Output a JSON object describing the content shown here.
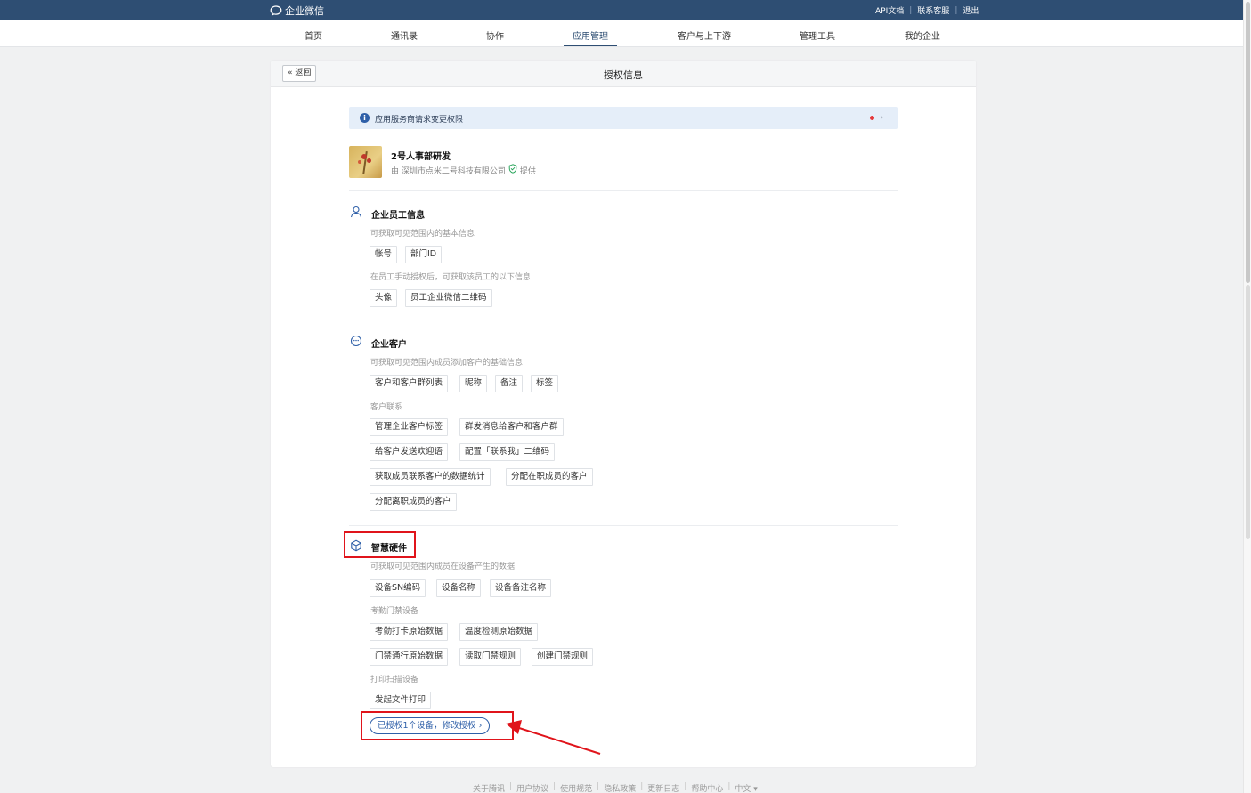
{
  "topbar": {
    "logo": "企业微信",
    "links": [
      "API文档",
      "联系客服",
      "退出"
    ]
  },
  "nav": {
    "items": [
      "首页",
      "通讯录",
      "协作",
      "应用管理",
      "客户与上下游",
      "管理工具",
      "我的企业"
    ],
    "active": "应用管理"
  },
  "header": {
    "back": "« 返回",
    "title": "授权信息"
  },
  "banner": {
    "text": "应用服务商请求变更权限"
  },
  "app": {
    "name": "2号人事部研发",
    "provider": "由 深圳市点米二号科技有限公司",
    "provider_suffix": "提供"
  },
  "sections": {
    "employee": {
      "title": "企业员工信息",
      "sub1": "可获取可见范围内的基本信息",
      "tags1": [
        "帐号",
        "部门ID"
      ],
      "sub2": "在员工手动授权后，可获取该员工的以下信息",
      "tags2": [
        "头像",
        "员工企业微信二维码"
      ]
    },
    "customer": {
      "title": "企业客户",
      "sub1": "可获取可见范围内成员添加客户的基础信息",
      "tags1": [
        "客户和客户群列表",
        "昵称",
        "备注",
        "标签"
      ],
      "sub2": "客户联系",
      "tags2": [
        "管理企业客户标签",
        "群发消息给客户和客户群",
        "给客户发送欢迎语",
        "配置「联系我」二维码",
        "获取成员联系客户的数据统计",
        "分配在职成员的客户",
        "分配离职成员的客户"
      ]
    },
    "hardware": {
      "title": "智慧硬件",
      "sub1": "可获取可见范围内成员在设备产生的数据",
      "tags1": [
        "设备SN编码",
        "设备名称",
        "设备备注名称"
      ],
      "sub2": "考勤门禁设备",
      "tags2": [
        "考勤打卡原始数据",
        "温度检测原始数据",
        "门禁通行原始数据",
        "读取门禁规则",
        "创建门禁规则"
      ],
      "sub3": "打印扫描设备",
      "tags3": [
        "发起文件打印"
      ],
      "auth_link": "已授权1个设备，修改授权 ›"
    }
  },
  "footer": {
    "links": [
      "关于腾讯",
      "用户协议",
      "使用规范",
      "隐私政策",
      "更新日志",
      "帮助中心",
      "中文 ▾"
    ]
  },
  "colors": {
    "brand": "#2e4e73",
    "link": "#2e5fa8",
    "highlight": "#e0141b"
  }
}
